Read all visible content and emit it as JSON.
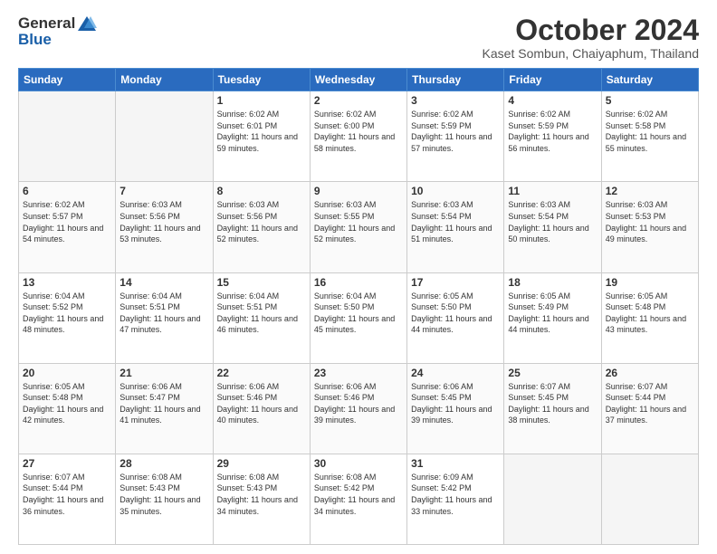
{
  "header": {
    "logo_general": "General",
    "logo_blue": "Blue",
    "title": "October 2024",
    "location": "Kaset Sombun, Chaiyaphum, Thailand"
  },
  "days_of_week": [
    "Sunday",
    "Monday",
    "Tuesday",
    "Wednesday",
    "Thursday",
    "Friday",
    "Saturday"
  ],
  "weeks": [
    [
      {
        "day": "",
        "sunrise": "",
        "sunset": "",
        "daylight": ""
      },
      {
        "day": "",
        "sunrise": "",
        "sunset": "",
        "daylight": ""
      },
      {
        "day": "1",
        "sunrise": "Sunrise: 6:02 AM",
        "sunset": "Sunset: 6:01 PM",
        "daylight": "Daylight: 11 hours and 59 minutes."
      },
      {
        "day": "2",
        "sunrise": "Sunrise: 6:02 AM",
        "sunset": "Sunset: 6:00 PM",
        "daylight": "Daylight: 11 hours and 58 minutes."
      },
      {
        "day": "3",
        "sunrise": "Sunrise: 6:02 AM",
        "sunset": "Sunset: 5:59 PM",
        "daylight": "Daylight: 11 hours and 57 minutes."
      },
      {
        "day": "4",
        "sunrise": "Sunrise: 6:02 AM",
        "sunset": "Sunset: 5:59 PM",
        "daylight": "Daylight: 11 hours and 56 minutes."
      },
      {
        "day": "5",
        "sunrise": "Sunrise: 6:02 AM",
        "sunset": "Sunset: 5:58 PM",
        "daylight": "Daylight: 11 hours and 55 minutes."
      }
    ],
    [
      {
        "day": "6",
        "sunrise": "Sunrise: 6:02 AM",
        "sunset": "Sunset: 5:57 PM",
        "daylight": "Daylight: 11 hours and 54 minutes."
      },
      {
        "day": "7",
        "sunrise": "Sunrise: 6:03 AM",
        "sunset": "Sunset: 5:56 PM",
        "daylight": "Daylight: 11 hours and 53 minutes."
      },
      {
        "day": "8",
        "sunrise": "Sunrise: 6:03 AM",
        "sunset": "Sunset: 5:56 PM",
        "daylight": "Daylight: 11 hours and 52 minutes."
      },
      {
        "day": "9",
        "sunrise": "Sunrise: 6:03 AM",
        "sunset": "Sunset: 5:55 PM",
        "daylight": "Daylight: 11 hours and 52 minutes."
      },
      {
        "day": "10",
        "sunrise": "Sunrise: 6:03 AM",
        "sunset": "Sunset: 5:54 PM",
        "daylight": "Daylight: 11 hours and 51 minutes."
      },
      {
        "day": "11",
        "sunrise": "Sunrise: 6:03 AM",
        "sunset": "Sunset: 5:54 PM",
        "daylight": "Daylight: 11 hours and 50 minutes."
      },
      {
        "day": "12",
        "sunrise": "Sunrise: 6:03 AM",
        "sunset": "Sunset: 5:53 PM",
        "daylight": "Daylight: 11 hours and 49 minutes."
      }
    ],
    [
      {
        "day": "13",
        "sunrise": "Sunrise: 6:04 AM",
        "sunset": "Sunset: 5:52 PM",
        "daylight": "Daylight: 11 hours and 48 minutes."
      },
      {
        "day": "14",
        "sunrise": "Sunrise: 6:04 AM",
        "sunset": "Sunset: 5:51 PM",
        "daylight": "Daylight: 11 hours and 47 minutes."
      },
      {
        "day": "15",
        "sunrise": "Sunrise: 6:04 AM",
        "sunset": "Sunset: 5:51 PM",
        "daylight": "Daylight: 11 hours and 46 minutes."
      },
      {
        "day": "16",
        "sunrise": "Sunrise: 6:04 AM",
        "sunset": "Sunset: 5:50 PM",
        "daylight": "Daylight: 11 hours and 45 minutes."
      },
      {
        "day": "17",
        "sunrise": "Sunrise: 6:05 AM",
        "sunset": "Sunset: 5:50 PM",
        "daylight": "Daylight: 11 hours and 44 minutes."
      },
      {
        "day": "18",
        "sunrise": "Sunrise: 6:05 AM",
        "sunset": "Sunset: 5:49 PM",
        "daylight": "Daylight: 11 hours and 44 minutes."
      },
      {
        "day": "19",
        "sunrise": "Sunrise: 6:05 AM",
        "sunset": "Sunset: 5:48 PM",
        "daylight": "Daylight: 11 hours and 43 minutes."
      }
    ],
    [
      {
        "day": "20",
        "sunrise": "Sunrise: 6:05 AM",
        "sunset": "Sunset: 5:48 PM",
        "daylight": "Daylight: 11 hours and 42 minutes."
      },
      {
        "day": "21",
        "sunrise": "Sunrise: 6:06 AM",
        "sunset": "Sunset: 5:47 PM",
        "daylight": "Daylight: 11 hours and 41 minutes."
      },
      {
        "day": "22",
        "sunrise": "Sunrise: 6:06 AM",
        "sunset": "Sunset: 5:46 PM",
        "daylight": "Daylight: 11 hours and 40 minutes."
      },
      {
        "day": "23",
        "sunrise": "Sunrise: 6:06 AM",
        "sunset": "Sunset: 5:46 PM",
        "daylight": "Daylight: 11 hours and 39 minutes."
      },
      {
        "day": "24",
        "sunrise": "Sunrise: 6:06 AM",
        "sunset": "Sunset: 5:45 PM",
        "daylight": "Daylight: 11 hours and 39 minutes."
      },
      {
        "day": "25",
        "sunrise": "Sunrise: 6:07 AM",
        "sunset": "Sunset: 5:45 PM",
        "daylight": "Daylight: 11 hours and 38 minutes."
      },
      {
        "day": "26",
        "sunrise": "Sunrise: 6:07 AM",
        "sunset": "Sunset: 5:44 PM",
        "daylight": "Daylight: 11 hours and 37 minutes."
      }
    ],
    [
      {
        "day": "27",
        "sunrise": "Sunrise: 6:07 AM",
        "sunset": "Sunset: 5:44 PM",
        "daylight": "Daylight: 11 hours and 36 minutes."
      },
      {
        "day": "28",
        "sunrise": "Sunrise: 6:08 AM",
        "sunset": "Sunset: 5:43 PM",
        "daylight": "Daylight: 11 hours and 35 minutes."
      },
      {
        "day": "29",
        "sunrise": "Sunrise: 6:08 AM",
        "sunset": "Sunset: 5:43 PM",
        "daylight": "Daylight: 11 hours and 34 minutes."
      },
      {
        "day": "30",
        "sunrise": "Sunrise: 6:08 AM",
        "sunset": "Sunset: 5:42 PM",
        "daylight": "Daylight: 11 hours and 34 minutes."
      },
      {
        "day": "31",
        "sunrise": "Sunrise: 6:09 AM",
        "sunset": "Sunset: 5:42 PM",
        "daylight": "Daylight: 11 hours and 33 minutes."
      },
      {
        "day": "",
        "sunrise": "",
        "sunset": "",
        "daylight": ""
      },
      {
        "day": "",
        "sunrise": "",
        "sunset": "",
        "daylight": ""
      }
    ]
  ]
}
